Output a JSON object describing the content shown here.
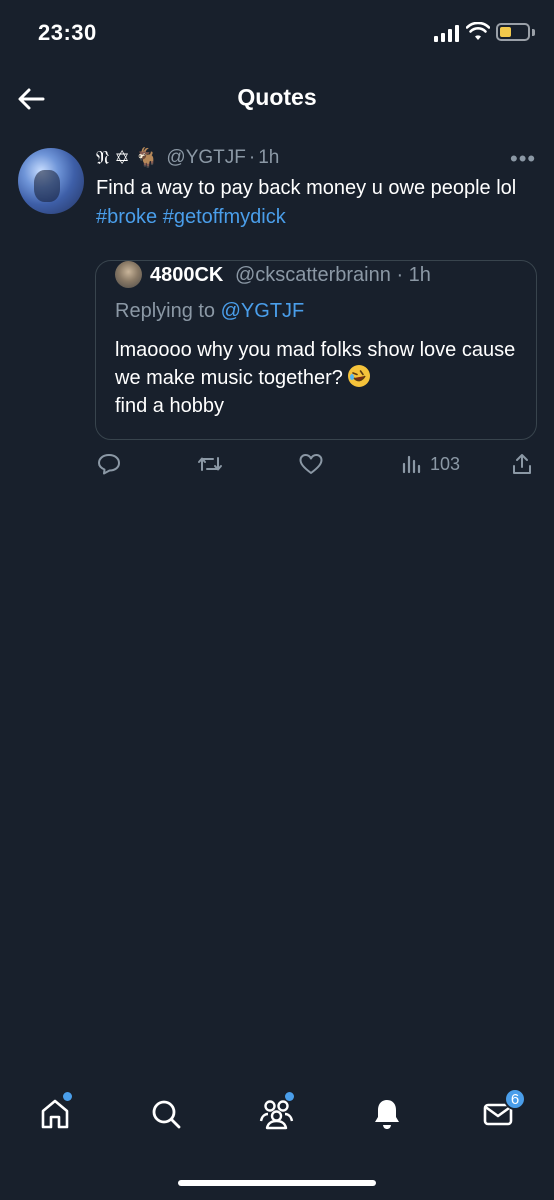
{
  "status_bar": {
    "time": "23:30",
    "battery_color": "#f2c94c"
  },
  "header": {
    "title": "Quotes",
    "back_icon": "arrow-left-icon"
  },
  "tweet": {
    "display_name": "𝔑 ✡ 🐐",
    "handle": "@YGTJF",
    "separator": "·",
    "time": "1h",
    "more": "•••",
    "text_plain": "Find a way to pay back money u owe people lol",
    "hashtags": [
      "#broke",
      "#getoffmydick"
    ]
  },
  "quote": {
    "display_name": "4800CK",
    "handle": "@ckscatterbrainn",
    "separator": "·",
    "time": "1h",
    "replying_prefix": "Replying to",
    "replying_to": "@YGTJF",
    "text_before_emoji": "lmaoooo why you mad folks show love cause we make music together?",
    "emoji": "🤣",
    "text_after_emoji": "find a hobby"
  },
  "actions": {
    "views_count": "103",
    "icons": [
      "reply-icon",
      "retweet-icon",
      "like-icon",
      "views-icon",
      "share-icon"
    ]
  },
  "bottom_nav": {
    "items": [
      "home-icon",
      "search-icon",
      "communities-icon",
      "notifications-icon",
      "messages-icon"
    ],
    "messages_badge": "6",
    "accent_color": "#4a9eea"
  }
}
